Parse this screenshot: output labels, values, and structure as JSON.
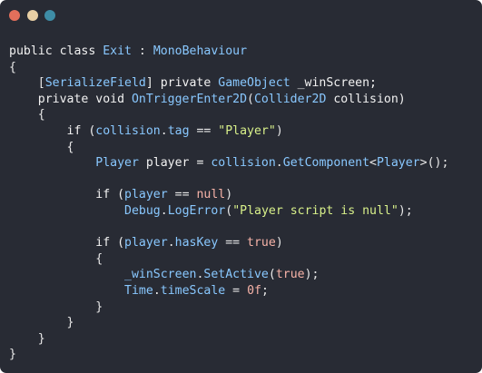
{
  "window": {
    "controls": {
      "close_color": "#e26f5b",
      "minimize_color": "#e8cfa4",
      "maximize_color": "#3e8da6"
    },
    "background": "#282b34"
  },
  "editor": {
    "language": "C#",
    "lines": [
      [
        {
          "t": "public class ",
          "c": "kw"
        },
        {
          "t": "Exit",
          "c": "type"
        },
        {
          "t": " : ",
          "c": "p"
        },
        {
          "t": "MonoBehaviour",
          "c": "type"
        }
      ],
      [
        {
          "t": "{",
          "c": "p"
        }
      ],
      [
        {
          "t": "    [",
          "c": "p"
        },
        {
          "t": "SerializeField",
          "c": "type"
        },
        {
          "t": "] private ",
          "c": "kw"
        },
        {
          "t": "GameObject",
          "c": "type"
        },
        {
          "t": " _winScreen;",
          "c": "id"
        }
      ],
      [
        {
          "t": "    private void ",
          "c": "kw"
        },
        {
          "t": "OnTriggerEnter2D",
          "c": "fn"
        },
        {
          "t": "(",
          "c": "p"
        },
        {
          "t": "Collider2D",
          "c": "type"
        },
        {
          "t": " collision)",
          "c": "id"
        }
      ],
      [
        {
          "t": "    {",
          "c": "p"
        }
      ],
      [
        {
          "t": "        if (",
          "c": "kw"
        },
        {
          "t": "collision",
          "c": "type"
        },
        {
          "t": ".",
          "c": "p"
        },
        {
          "t": "tag",
          "c": "type"
        },
        {
          "t": " == ",
          "c": "p"
        },
        {
          "t": "\"Player\"",
          "c": "str"
        },
        {
          "t": ")",
          "c": "p"
        }
      ],
      [
        {
          "t": "        {",
          "c": "p"
        }
      ],
      [
        {
          "t": "            ",
          "c": "p"
        },
        {
          "t": "Player",
          "c": "type"
        },
        {
          "t": " player = ",
          "c": "id"
        },
        {
          "t": "collision",
          "c": "type"
        },
        {
          "t": ".",
          "c": "p"
        },
        {
          "t": "GetComponent",
          "c": "fn"
        },
        {
          "t": "<",
          "c": "p"
        },
        {
          "t": "Player",
          "c": "type"
        },
        {
          "t": ">();",
          "c": "p"
        }
      ],
      [
        {
          "t": "",
          "c": "p"
        }
      ],
      [
        {
          "t": "            if (",
          "c": "kw"
        },
        {
          "t": "player",
          "c": "type"
        },
        {
          "t": " == ",
          "c": "p"
        },
        {
          "t": "null",
          "c": "lit"
        },
        {
          "t": ")",
          "c": "p"
        }
      ],
      [
        {
          "t": "                ",
          "c": "p"
        },
        {
          "t": "Debug",
          "c": "type"
        },
        {
          "t": ".",
          "c": "p"
        },
        {
          "t": "LogError",
          "c": "fn"
        },
        {
          "t": "(",
          "c": "p"
        },
        {
          "t": "\"Player script is null\"",
          "c": "str"
        },
        {
          "t": ");",
          "c": "p"
        }
      ],
      [
        {
          "t": "",
          "c": "p"
        }
      ],
      [
        {
          "t": "            if (",
          "c": "kw"
        },
        {
          "t": "player",
          "c": "type"
        },
        {
          "t": ".",
          "c": "p"
        },
        {
          "t": "hasKey",
          "c": "type"
        },
        {
          "t": " == ",
          "c": "p"
        },
        {
          "t": "true",
          "c": "lit"
        },
        {
          "t": ")",
          "c": "p"
        }
      ],
      [
        {
          "t": "            {",
          "c": "p"
        }
      ],
      [
        {
          "t": "                ",
          "c": "p"
        },
        {
          "t": "_winScreen",
          "c": "type"
        },
        {
          "t": ".",
          "c": "p"
        },
        {
          "t": "SetActive",
          "c": "fn"
        },
        {
          "t": "(",
          "c": "p"
        },
        {
          "t": "true",
          "c": "lit"
        },
        {
          "t": ");",
          "c": "p"
        }
      ],
      [
        {
          "t": "                ",
          "c": "p"
        },
        {
          "t": "Time",
          "c": "type"
        },
        {
          "t": ".",
          "c": "p"
        },
        {
          "t": "timeScale",
          "c": "type"
        },
        {
          "t": " = ",
          "c": "p"
        },
        {
          "t": "0f",
          "c": "num"
        },
        {
          "t": ";",
          "c": "p"
        }
      ],
      [
        {
          "t": "            }",
          "c": "p"
        }
      ],
      [
        {
          "t": "        }",
          "c": "p"
        }
      ],
      [
        {
          "t": "    }",
          "c": "p"
        }
      ],
      [
        {
          "t": "}",
          "c": "p"
        }
      ]
    ]
  }
}
